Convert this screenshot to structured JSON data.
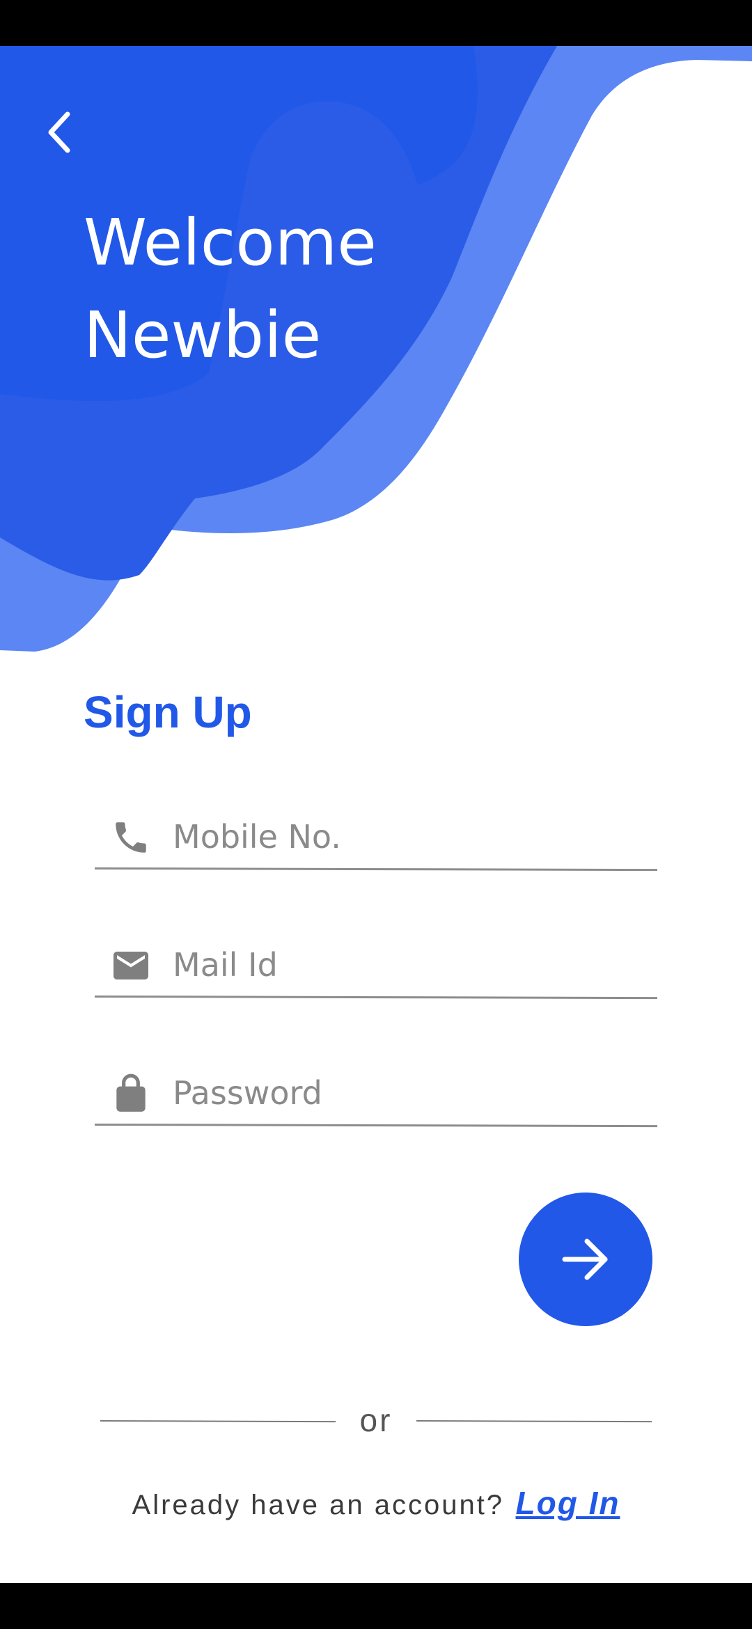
{
  "header": {
    "welcome_line1": "Welcome",
    "welcome_line2": "Newbie"
  },
  "form": {
    "title": "Sign Up",
    "fields": [
      {
        "placeholder": "Mobile No.",
        "value": "",
        "icon": "phone-icon"
      },
      {
        "placeholder": "Mail Id",
        "value": "",
        "icon": "mail-icon"
      },
      {
        "placeholder": "Password",
        "value": "",
        "icon": "lock-icon"
      }
    ],
    "submit_icon": "arrow-right-icon"
  },
  "divider": {
    "text": "or"
  },
  "footer": {
    "prompt": "Already have an account?",
    "login_label": "Log In"
  },
  "colors": {
    "primary": "#2158e8",
    "primary_light": "#5b86f3",
    "icon_gray": "#7f7f7f",
    "background": "#ffffff"
  },
  "icons": {
    "back": "chevron-left-icon"
  }
}
